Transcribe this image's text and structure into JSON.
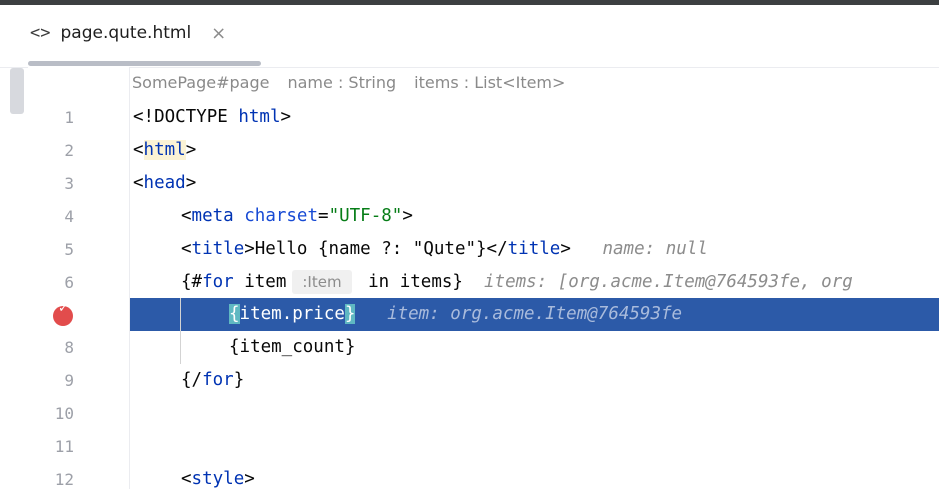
{
  "tab": {
    "icon": "<>",
    "label": "page.qute.html",
    "close": "×"
  },
  "inlay_header": {
    "page": "SomePage#page",
    "param1": "name : String",
    "param2": "items : List<Item>"
  },
  "lines": {
    "n1": "1",
    "n2": "2",
    "n3": "3",
    "n4": "4",
    "n5": "5",
    "n6": "6",
    "n8": "8",
    "n9": "9",
    "n10": "10",
    "n11": "11",
    "n12": "12"
  },
  "code": {
    "l1_a": "<!DOCTYPE ",
    "l1_b": "html",
    "l1_c": ">",
    "l2_a": "<",
    "l2_b": "html",
    "l2_c": ">",
    "l3_a": "<",
    "l3_b": "head",
    "l3_c": ">",
    "l4_a": "<",
    "l4_b": "meta",
    "l4_c": " ",
    "l4_d": "charset",
    "l4_e": "=",
    "l4_f": "\"UTF-8\"",
    "l4_g": ">",
    "l5_a": "<",
    "l5_b": "title",
    "l5_c": ">Hello {name ?: \"Qute\"}</",
    "l5_d": "title",
    "l5_e": ">",
    "l5_hint": "name: null",
    "l6_a": "{#",
    "l6_b": "for",
    "l6_c": " item",
    "l6_chip": ":Item",
    "l6_d": " in items}",
    "l6_hint": "items: [org.acme.Item@764593fe, org",
    "l7_open": "{",
    "l7_mid": "item.price",
    "l7_close": "}",
    "l7_hint": "item: org.acme.Item@764593fe",
    "l8": "{item_count}",
    "l9_a": "{/",
    "l9_b": "for",
    "l9_c": "}",
    "l12_a": "<",
    "l12_b": "style",
    "l12_c": ">"
  },
  "colors": {
    "selection": "#2c5aa8",
    "breakpoint": "#e24c4c",
    "keyword": "#0033b3",
    "string": "#067d17"
  },
  "breakpoint": {
    "icon": "breakpoint-icon",
    "line": "7"
  }
}
